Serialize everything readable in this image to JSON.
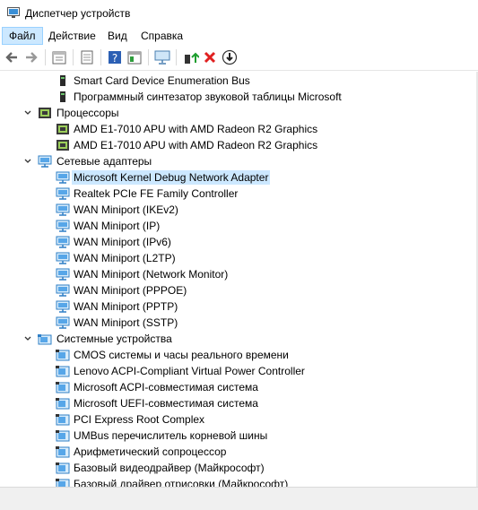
{
  "window": {
    "title": "Диспетчер устройств"
  },
  "menu": [
    {
      "label": "Файл",
      "active": true
    },
    {
      "label": "Действие",
      "active": false
    },
    {
      "label": "Вид",
      "active": false
    },
    {
      "label": "Справка",
      "active": false
    }
  ],
  "toolbar": [
    "back-arrow-icon",
    "forward-arrow-icon",
    "sep",
    "properties-list-icon",
    "sep",
    "print-page-icon",
    "sep",
    "help-icon",
    "view-panel-icon",
    "sep",
    "monitor-scan-icon",
    "sep",
    "update-driver-icon",
    "uninstall-x-icon",
    "download-driver-icon"
  ],
  "tree": [
    {
      "label": "Smart Card Device Enumeration Bus",
      "level": 2,
      "icon": "system-device-icon"
    },
    {
      "label": "Программный синтезатор звуковой таблицы Microsoft",
      "level": 2,
      "icon": "system-device-icon"
    },
    {
      "label": "Процессоры",
      "level": 1,
      "icon": "processor-icon",
      "expanded": true
    },
    {
      "label": "AMD E1-7010 APU with AMD Radeon R2 Graphics",
      "level": 2,
      "icon": "processor-icon"
    },
    {
      "label": "AMD E1-7010 APU with AMD Radeon R2 Graphics",
      "level": 2,
      "icon": "processor-icon"
    },
    {
      "label": "Сетевые адаптеры",
      "level": 1,
      "icon": "network-adapter-icon",
      "expanded": true
    },
    {
      "label": "Microsoft Kernel Debug Network Adapter",
      "level": 2,
      "icon": "network-adapter-icon",
      "selected": true
    },
    {
      "label": "Realtek PCIe FE Family Controller",
      "level": 2,
      "icon": "network-adapter-icon"
    },
    {
      "label": "WAN Miniport (IKEv2)",
      "level": 2,
      "icon": "network-adapter-icon"
    },
    {
      "label": "WAN Miniport (IP)",
      "level": 2,
      "icon": "network-adapter-icon"
    },
    {
      "label": "WAN Miniport (IPv6)",
      "level": 2,
      "icon": "network-adapter-icon"
    },
    {
      "label": "WAN Miniport (L2TP)",
      "level": 2,
      "icon": "network-adapter-icon"
    },
    {
      "label": "WAN Miniport (Network Monitor)",
      "level": 2,
      "icon": "network-adapter-icon"
    },
    {
      "label": "WAN Miniport (PPPOE)",
      "level": 2,
      "icon": "network-adapter-icon"
    },
    {
      "label": "WAN Miniport (PPTP)",
      "level": 2,
      "icon": "network-adapter-icon"
    },
    {
      "label": "WAN Miniport (SSTP)",
      "level": 2,
      "icon": "network-adapter-icon"
    },
    {
      "label": "Системные устройства",
      "level": 1,
      "icon": "system-folder-icon",
      "expanded": true
    },
    {
      "label": "CMOS системы и часы реального времени",
      "level": 2,
      "icon": "system-device-icon2"
    },
    {
      "label": "Lenovo ACPI-Compliant Virtual Power Controller",
      "level": 2,
      "icon": "system-device-icon2"
    },
    {
      "label": "Microsoft ACPI-совместимая система",
      "level": 2,
      "icon": "system-device-icon2"
    },
    {
      "label": "Microsoft UEFI-совместимая система",
      "level": 2,
      "icon": "system-device-icon2"
    },
    {
      "label": "PCI Express Root Complex",
      "level": 2,
      "icon": "system-device-icon2"
    },
    {
      "label": "UMBus перечислитель корневой шины",
      "level": 2,
      "icon": "system-device-icon2"
    },
    {
      "label": "Арифметический сопроцессор",
      "level": 2,
      "icon": "system-device-icon2"
    },
    {
      "label": "Базовый видеодрайвер (Майкрософт)",
      "level": 2,
      "icon": "system-device-icon2"
    },
    {
      "label": "Базовый драйвер отрисовки (Майкрософт)",
      "level": 2,
      "icon": "system-device-icon2"
    }
  ]
}
